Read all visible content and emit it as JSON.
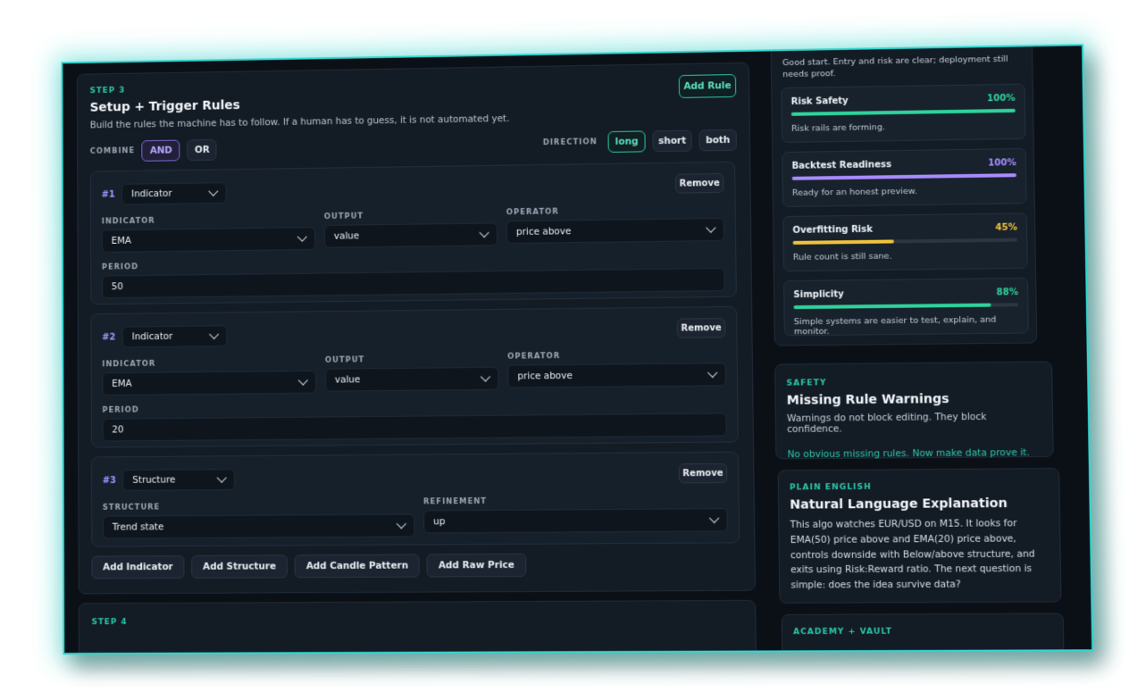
{
  "step3": {
    "eyebrow": "STEP 3",
    "title": "Setup + Trigger Rules",
    "subtitle": "Build the rules the machine has to follow. If a human has to guess, it is not automated yet.",
    "add_rule": "Add Rule",
    "combine_label": "COMBINE",
    "combine_options": [
      "AND",
      "OR"
    ],
    "combine_selected": "AND",
    "direction_label": "DIRECTION",
    "direction_options": [
      "long",
      "short",
      "both"
    ],
    "direction_selected": "long",
    "remove_label": "Remove",
    "rules": [
      {
        "num": "#1",
        "type": "Indicator",
        "fields": {
          "indicator_label": "INDICATOR",
          "indicator": "EMA",
          "output_label": "OUTPUT",
          "output": "value",
          "operator_label": "OPERATOR",
          "operator": "price above",
          "period_label": "PERIOD",
          "period": "50"
        }
      },
      {
        "num": "#2",
        "type": "Indicator",
        "fields": {
          "indicator_label": "INDICATOR",
          "indicator": "EMA",
          "output_label": "OUTPUT",
          "output": "value",
          "operator_label": "OPERATOR",
          "operator": "price above",
          "period_label": "PERIOD",
          "period": "20"
        }
      },
      {
        "num": "#3",
        "type": "Structure",
        "fields": {
          "structure_label": "STRUCTURE",
          "structure": "Trend state",
          "refinement_label": "REFINEMENT",
          "refinement": "up"
        }
      }
    ],
    "add_buttons": [
      "Add Indicator",
      "Add Structure",
      "Add Candle Pattern",
      "Add Raw Price"
    ]
  },
  "step4": {
    "eyebrow": "STEP 4"
  },
  "score": {
    "intro": "Good start. Entry and risk are clear; deployment still needs proof.",
    "metrics": [
      {
        "name": "Risk Safety",
        "value": "100%",
        "fill": 1.0,
        "color": "#2fd39b",
        "note": "Risk rails are forming."
      },
      {
        "name": "Backtest Readiness",
        "value": "100%",
        "fill": 1.0,
        "color": "#a88cff",
        "note": "Ready for an honest preview."
      },
      {
        "name": "Overfitting Risk",
        "value": "45%",
        "fill": 0.45,
        "color": "#f2c33a",
        "note": "Rule count is still sane."
      },
      {
        "name": "Simplicity",
        "value": "88%",
        "fill": 0.88,
        "color": "#2fd39b",
        "note": "Simple systems are easier to test, explain, and monitor."
      }
    ]
  },
  "safety": {
    "eyebrow": "SAFETY",
    "title": "Missing Rule Warnings",
    "desc": "Warnings do not block editing. They block confidence.",
    "ok": "No obvious missing rules. Now make data prove it."
  },
  "plain": {
    "eyebrow": "PLAIN ENGLISH",
    "title": "Natural Language Explanation",
    "desc": "This algo watches EUR/USD on M15. It looks for EMA(50) price above and EMA(20) price above, controls downside with Below/above structure, and exits using Risk:Reward ratio. The next question is simple: does the idea survive data?"
  },
  "academy": {
    "eyebrow": "ACADEMY + VAULT"
  },
  "colors": {
    "accent": "#2bc7a6",
    "frame_glow": "#2fd6cf",
    "purple": "#a394ff"
  }
}
